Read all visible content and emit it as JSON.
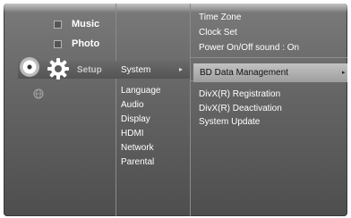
{
  "categories": [
    {
      "label": "Music",
      "icon": "music-icon"
    },
    {
      "label": "Photo",
      "icon": "photo-icon"
    }
  ],
  "setup": {
    "label": "Setup",
    "icon": "gear-icon",
    "disc_icon": "disc-icon"
  },
  "secondary_icon": "globe-icon",
  "system": {
    "label": "System",
    "arrow": "▸"
  },
  "submenu": [
    "Language",
    "Audio",
    "Display",
    "HDMI",
    "Network",
    "Parental"
  ],
  "options_top": [
    "Time Zone",
    "Clock Set",
    "Power On/Off sound :  On"
  ],
  "selected_option": {
    "label": "BD Data Management",
    "arrow": "▸"
  },
  "options_lower": [
    "DivX(R) Registration",
    "DivX(R) Deactivation",
    "System Update"
  ],
  "colors": {
    "background": "#6a6a6a",
    "highlight": "#b0b0b0",
    "text": "#ffffff"
  }
}
